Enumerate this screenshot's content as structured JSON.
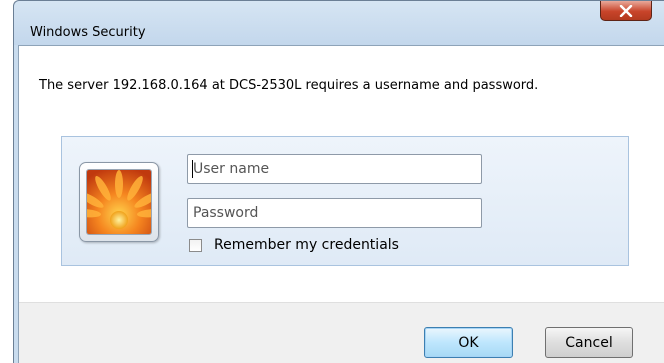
{
  "dialog": {
    "title": "Windows Security",
    "close_glyph": "X",
    "message": "The server 192.168.0.164 at DCS-2530L requires a username and password."
  },
  "credentials": {
    "tile_icon": "user-picture-flower",
    "username_placeholder": "User name",
    "username_value": "",
    "password_placeholder": "Password",
    "password_value": "",
    "remember_label": "Remember my credentials",
    "remember_checked": false
  },
  "buttons": {
    "ok_label": "OK",
    "cancel_label": "Cancel"
  },
  "colors": {
    "close_button": "#c8442a",
    "panel_border": "#a9c3df",
    "window_frame": "#c9dcee"
  }
}
